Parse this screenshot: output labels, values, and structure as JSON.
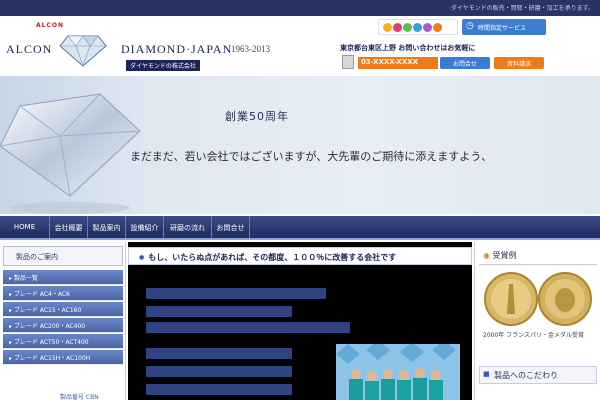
{
  "topbar": {
    "tagline": "ダイヤモンドの販売・買取・研磨・加工を承ります。"
  },
  "logo": {
    "mini_text": "ALCON",
    "word1": "ALCON",
    "word2": "DIAMOND·JAPAN",
    "years": "1963-2013",
    "subtitle": "ダイヤモンドの株式会社"
  },
  "header": {
    "time_service": "時間指定サービス",
    "contact_line": "東京都台東区上野 お問い合わせはお気軽に",
    "phone": "03-XXXX-XXXX",
    "inquiry_button": "お問合せ",
    "docs_button": "資料請求"
  },
  "hero": {
    "headline": "創業50周年",
    "subline": "まだまだ、若い会社ではございますが、大先輩のご期待に添えますよう、"
  },
  "nav": {
    "items": [
      "HOME",
      "会社概要",
      "製品案内",
      "設備紹介",
      "研磨の流れ",
      "お問合せ"
    ]
  },
  "sidebar": {
    "heading": "製品のご案内",
    "items": [
      "製品一覧",
      "ブレード AC4・AC6",
      "ブレード AC15・AC160",
      "ブレード AC200・AC400",
      "ブレード ACT50・ACT400",
      "ブレード AC15H・AC100H"
    ],
    "bottom_link": "製品番号 CBN"
  },
  "main": {
    "title": "もし、いたらぬ点があれば、その都度、１００％に改善する会社です"
  },
  "right": {
    "award_heading": "受賞例",
    "award_caption": "2000年 フランスパリ・金メダル受賞",
    "commitment_heading": "製品へのこだわり"
  },
  "colors": {
    "navy": "#1c2458",
    "nav_gradient_top": "#3c4c8a",
    "accent_orange": "#f07a1a",
    "accent_blue": "#3a7bd5"
  }
}
